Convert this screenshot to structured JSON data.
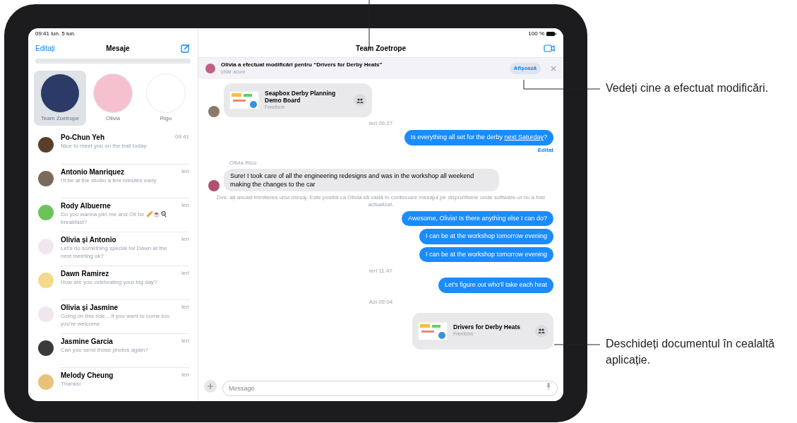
{
  "status_bar": {
    "time_date": "09:41 lun. 5 iun.",
    "battery": "100 %"
  },
  "sidebar": {
    "edit": "Editați",
    "title": "Mesaje",
    "pinned": [
      {
        "name": "Team Zoetrope",
        "selected": true,
        "color": "#2b3a67"
      },
      {
        "name": "Olivia",
        "selected": false,
        "color": "#f6c1cf"
      },
      {
        "name": "Rigo",
        "selected": false,
        "color": "#ffffff"
      }
    ],
    "conversations": [
      {
        "name": "Po-Chun Yeh",
        "preview": "Nice to meet you on the trail today",
        "time": "09:41",
        "color": "#5a3e2b"
      },
      {
        "name": "Antonio Manriquez",
        "preview": "I'll be at the studio a few minutes early",
        "time": "Ieri",
        "color": "#7a6a5a"
      },
      {
        "name": "Rody Albuerne",
        "preview": "Do you wanna join me and Oli for 🥖☕🍳 breakfast?",
        "time": "Ieri",
        "color": "#6cc35a"
      },
      {
        "name": "Olivia și Antonio",
        "preview": "Let's do something special for Dawn at the next meeting ok?",
        "time": "Ieri",
        "color": "#f1e6ee"
      },
      {
        "name": "Dawn Ramirez",
        "preview": "How are you celebrating your big day?",
        "time": "Ieri",
        "color": "#f3d98a"
      },
      {
        "name": "Olivia și Jasmine",
        "preview": "Going on this ride... if you want to come too you're welcome",
        "time": "Ieri",
        "color": "#f1e6ee"
      },
      {
        "name": "Jasmine Garcia",
        "preview": "Can you send those photos again?",
        "time": "Ieri",
        "color": "#3a3a3a"
      },
      {
        "name": "Melody Cheung",
        "preview": "Thanks!",
        "time": "Ieri",
        "color": "#e8c27a"
      }
    ]
  },
  "conversation": {
    "title": "Team Zoetrope",
    "banner": {
      "text": "Olivia a efectuat modificări pentru “Drivers for Derby Heats”",
      "time": "chiar acum",
      "button": "Afișează"
    },
    "messages": [
      {
        "kind": "received_card",
        "title": "Seapbox Derby Planning Demo Board",
        "app": "Freeform"
      },
      {
        "kind": "timestamp",
        "text": "Ieri 09:27"
      },
      {
        "kind": "sent",
        "text": "Is everything all set for the derby ",
        "link": "next Saturday",
        "tail": "?",
        "status": "Editat"
      },
      {
        "kind": "received",
        "sender": "Olivia Rico",
        "text": "Sure! I took care of all the engineering redesigns and was in the workshop all weekend making the changes to the car"
      },
      {
        "kind": "notice",
        "text": "Dvs. ați anulat trimiterea unui mesaj. Este posibil ca Olivia să vadă în continuare mesajul pe dispozitivele unde software-ul nu a fost actualizat."
      },
      {
        "kind": "sent",
        "text": "Awesome, Olivia! Is there anything else I can do?"
      },
      {
        "kind": "sent",
        "text": "I can be at the workshop tomorrow evening"
      },
      {
        "kind": "sent",
        "text": "I can be at the workshop tomorrow evening"
      },
      {
        "kind": "timestamp",
        "text": "Ieri 11:47"
      },
      {
        "kind": "sent",
        "text": "Let's figure out who'll take each heat"
      },
      {
        "kind": "timestamp",
        "text": "Azi 09:04"
      },
      {
        "kind": "sent_card",
        "title": "Drivers for Derby Heats",
        "app": "Freeform"
      }
    ],
    "composer": {
      "placeholder": "Message"
    }
  },
  "callouts": [
    {
      "text": "Vedeți cine a efectuat modificări."
    },
    {
      "text": "Deschideți documentul în cealaltă aplicație."
    }
  ]
}
